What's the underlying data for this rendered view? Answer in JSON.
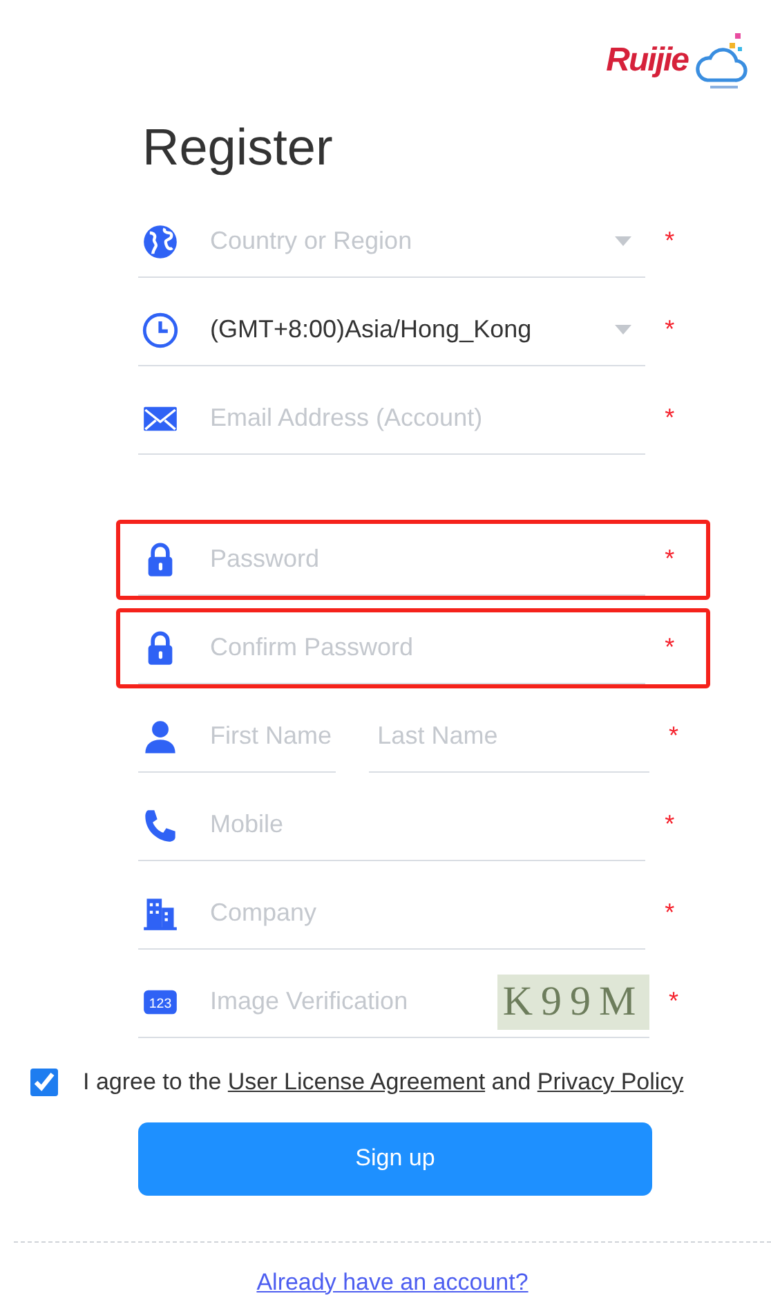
{
  "logo": {
    "text": "Ruijie"
  },
  "title": "Register",
  "field_groups": [
    [
      {
        "kind": "select",
        "placeholder": "Country or Region",
        "required": true,
        "highlighted": false
      },
      {
        "kind": "select",
        "value": "(GMT+8:00)Asia/Hong_Kong",
        "required": true,
        "highlighted": false
      },
      {
        "kind": "text",
        "placeholder": "Email Address (Account)",
        "required": true,
        "highlighted": false
      }
    ],
    [
      {
        "kind": "text",
        "placeholder": "Password",
        "required": true,
        "highlighted": true
      },
      {
        "kind": "text",
        "placeholder": "Confirm Password",
        "required": true,
        "highlighted": true
      },
      {
        "kind": "name",
        "placeholder": "First Name",
        "placeholder_2": "Last Name",
        "required": true,
        "highlighted": false
      },
      {
        "kind": "text",
        "placeholder": "Mobile",
        "required": true,
        "highlighted": false
      },
      {
        "kind": "text",
        "placeholder": "Company",
        "required": true,
        "highlighted": false
      },
      {
        "kind": "captcha",
        "icon_text": "123",
        "placeholder": "Image Verification",
        "captcha": "K99M",
        "required": true,
        "highlighted": false
      }
    ]
  ],
  "required_mark": "*",
  "agreement": {
    "checked": true,
    "text_1": "I agree to the",
    "link_1": "User License Agreement",
    "text_2": "and",
    "link_2": "Privacy Policy"
  },
  "submit": "Sign up",
  "login_link": "Already have an account?"
}
